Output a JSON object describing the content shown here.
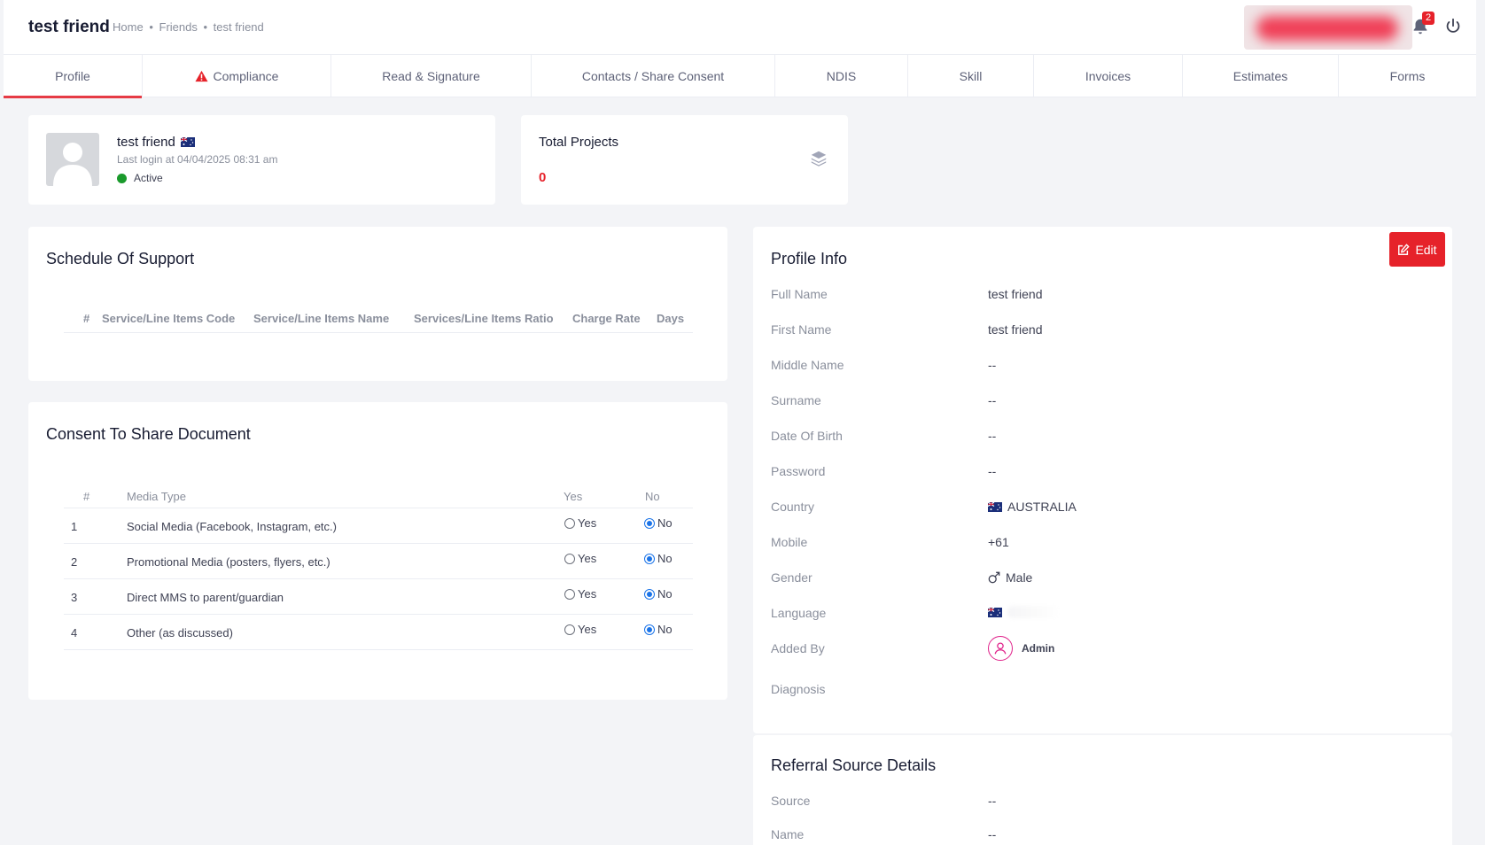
{
  "header": {
    "title": "test friend",
    "breadcrumbs": [
      "Home",
      "•",
      "Friends",
      "•",
      "test friend"
    ],
    "notification_count": "2"
  },
  "tabs": [
    {
      "label": "Profile",
      "active": true
    },
    {
      "label": "Compliance",
      "warning": true
    },
    {
      "label": "Read & Signature"
    },
    {
      "label": "Contacts / Share Consent"
    },
    {
      "label": "NDIS"
    },
    {
      "label": "Skill"
    },
    {
      "label": "Invoices"
    },
    {
      "label": "Estimates"
    },
    {
      "label": "Forms"
    }
  ],
  "profile": {
    "name": "test friend",
    "last_login": "Last login at 04/04/2025 08:31 am",
    "status": "Active"
  },
  "projects": {
    "title": "Total Projects",
    "value": "0"
  },
  "schedule": {
    "title": "Schedule Of Support",
    "columns": [
      "#",
      "Service/Line Items Code",
      "Service/Line Items Name",
      "Services/Line Items Ratio",
      "Charge Rate",
      "Days"
    ]
  },
  "consent": {
    "title": "Consent To Share Document",
    "columns": [
      "#",
      "Media Type",
      "Yes",
      "No"
    ],
    "yes_label": "Yes",
    "no_label": "No",
    "rows": [
      {
        "num": "1",
        "media": "Social Media (Facebook, Instagram, etc.)",
        "selected": "No"
      },
      {
        "num": "2",
        "media": "Promotional Media (posters, flyers, etc.)",
        "selected": "No"
      },
      {
        "num": "3",
        "media": "Direct MMS to parent/guardian",
        "selected": "No"
      },
      {
        "num": "4",
        "media": "Other (as discussed)",
        "selected": "No"
      }
    ]
  },
  "profile_info": {
    "title": "Profile Info",
    "edit_label": "Edit",
    "fields": [
      {
        "label": "Full Name",
        "value": "test friend"
      },
      {
        "label": "First Name",
        "value": "test friend"
      },
      {
        "label": "Middle Name",
        "value": "--"
      },
      {
        "label": "Surname",
        "value": "--"
      },
      {
        "label": "Date Of Birth",
        "value": "--"
      },
      {
        "label": "Password",
        "value": "--"
      },
      {
        "label": "Country",
        "value": "AUSTRALIA"
      },
      {
        "label": "Mobile",
        "value": "+61"
      },
      {
        "label": "Gender",
        "value": "Male"
      },
      {
        "label": "Language",
        "value": ""
      },
      {
        "label": "Added By",
        "value": "Admin"
      },
      {
        "label": "Diagnosis",
        "value": ""
      }
    ]
  },
  "referral": {
    "title": "Referral Source Details",
    "fields": [
      {
        "label": "Source",
        "value": "--"
      },
      {
        "label": "Name",
        "value": "--"
      }
    ]
  },
  "colors": {
    "accent": "#e6222a",
    "active_status": "#1a9a2c",
    "radio_selected": "#1a73e8"
  }
}
